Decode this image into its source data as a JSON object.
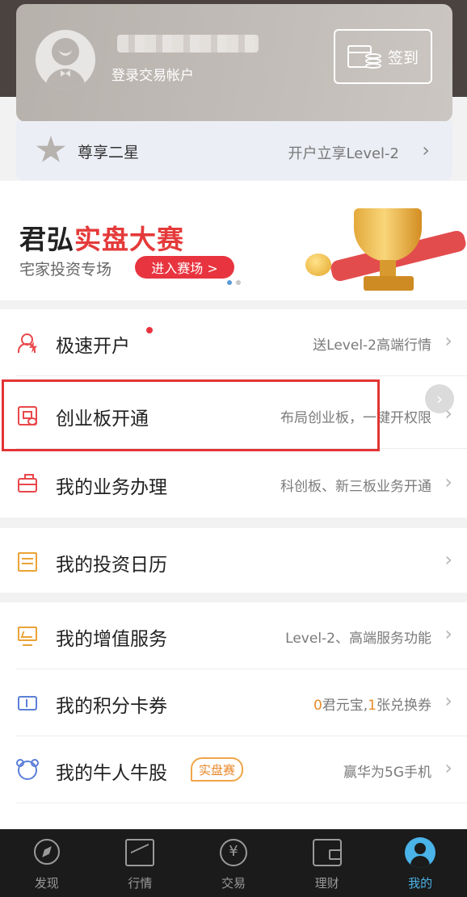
{
  "account": {
    "login_text": "登录交易帐户",
    "signin_label": "签到"
  },
  "level": {
    "title": "尊享二星",
    "promo": "开户立享Level-2",
    "arrow": "›"
  },
  "banner": {
    "title_black": "君弘",
    "title_red": "实盘大赛",
    "subtitle": "宅家投资专场",
    "button": "进入赛场 >"
  },
  "list_group_1": [
    {
      "label": "极速开户",
      "desc": "送Level-2高端行情"
    },
    {
      "label": "创业板开通",
      "desc": "布局创业板，一键开权限"
    },
    {
      "label": "我的业务办理",
      "desc": "科创板、新三板业务开通"
    }
  ],
  "list_group_2": [
    {
      "label": "我的投资日历",
      "desc": ""
    }
  ],
  "list_group_3": [
    {
      "label": "我的增值服务",
      "desc": "Level-2、高端服务功能"
    },
    {
      "label": "我的积分卡券",
      "desc_num1": "0",
      "desc_text1": "君元宝,",
      "desc_num2": "1",
      "desc_text2": "张兑换券"
    },
    {
      "label": "我的牛人牛股",
      "tag": "实盘赛",
      "desc": "赢华为5G手机"
    }
  ],
  "chevron": "›",
  "bottom_nav": [
    {
      "label": "发现",
      "icon": "compass-icon"
    },
    {
      "label": "行情",
      "icon": "chart-icon"
    },
    {
      "label": "交易",
      "icon": "yen-exchange-icon"
    },
    {
      "label": "理财",
      "icon": "wallet-icon"
    },
    {
      "label": "我的",
      "icon": "user-icon",
      "active": true
    }
  ],
  "colors": {
    "accent_red": "#e8343f",
    "accent_orange": "#eaa337",
    "accent_blue": "#4ab3e8"
  }
}
